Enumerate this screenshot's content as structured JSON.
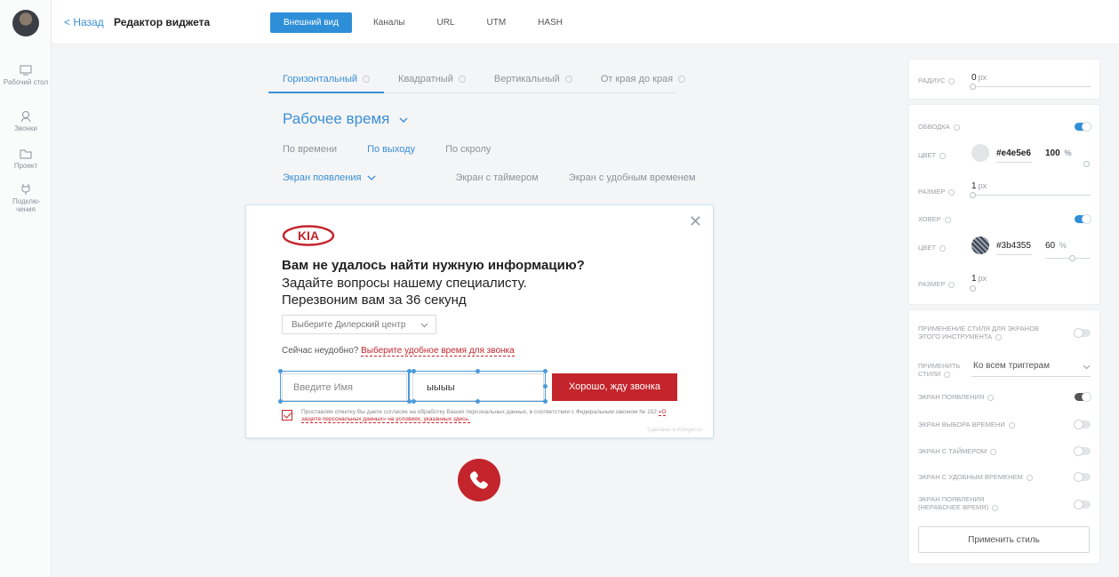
{
  "rail": {
    "items": [
      {
        "label": "Рабочий стол",
        "icon": "desktop-icon"
      },
      {
        "label": "Звонки",
        "icon": "user-call-icon"
      },
      {
        "label": "Проект",
        "icon": "folder-icon"
      },
      {
        "label": "Подклю-чения",
        "icon": "plug-icon"
      }
    ]
  },
  "topbar": {
    "back_label": "< Назад",
    "title": "Редактор виджета",
    "tabs": [
      "Внешний вид",
      "Каналы",
      "URL",
      "UTM",
      "HASH"
    ]
  },
  "main": {
    "format_tabs": [
      "Горизонтальный",
      "Квадратный",
      "Вертикальный",
      "От края до края"
    ],
    "mode_title": "Рабочее время",
    "trigger_tabs": [
      "По времени",
      "По выходу",
      "По скролу"
    ],
    "screen_tabs": [
      "Экран появления",
      "Экран с таймером",
      "Экран с удобным временем"
    ]
  },
  "widget": {
    "heading": "Вам не удалось найти нужную информацию?",
    "subheading_line1": "Задайте вопросы нашему специалисту.",
    "subheading_line2": "Перезвоним вам за 36 секунд",
    "dealer_placeholder": "Выберите Дилерский центр",
    "inconvenient_text": "Сейчас неудобно?",
    "inconvenient_link": "Выберите удобное время для звонка",
    "name_placeholder": "Введите Имя",
    "phone_value": "ыыыы",
    "submit_label": "Хорошо, жду звонка",
    "consent_text": "Проставляя отметку Вы даете согласие на обработку Ваших персональных данных, в соответствии с Федеральным законом № 152",
    "consent_link": "«О защите персональных данных» на условиях, указанных здесь.",
    "made_in": "Сделано в Konget.ru"
  },
  "panel": {
    "radius_label": "Радиус",
    "radius_value": "0",
    "border_label": "Обводка",
    "color_label": "Цвет",
    "border_color": "#e4e5e6",
    "border_color_text": "#e4e5e6",
    "border_opacity": "100",
    "size_label": "Размер",
    "border_size": "1",
    "hover_label": "Ховер",
    "hover_color": "#3b4355",
    "hover_color_text": "#3b4355",
    "hover_opacity": "60",
    "hover_size": "1",
    "unit_px": "px",
    "unit_pct": "%",
    "apply_screens_label": "Применение стиля для экранов этого инструмента",
    "apply_to_label": "Применить стили",
    "apply_to_value": "Ко всем триггерам",
    "screen_appear": "Экран появления",
    "screen_choose_time": "Экран выбора времени",
    "screen_timer": "Экран с таймером",
    "screen_convenient": "Экран с удобным временем",
    "screen_appear_offhours": "Экран появления (нерабочее время)",
    "apply_button": "Применить стиль"
  }
}
